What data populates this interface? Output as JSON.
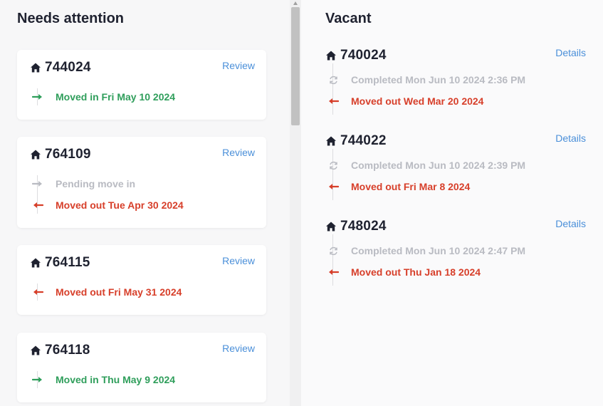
{
  "left": {
    "title": "Needs attention",
    "cards": [
      {
        "unit": "744024",
        "action": "Review",
        "events": [
          {
            "text": "Moved in Fri May 10 2024",
            "status": "green",
            "icon": "arrow-right-icon"
          }
        ]
      },
      {
        "unit": "764109",
        "action": "Review",
        "events": [
          {
            "text": "Pending move in",
            "status": "gray",
            "icon": "arrow-right-icon"
          },
          {
            "text": "Moved out Tue Apr 30 2024",
            "status": "red",
            "icon": "arrow-left-icon"
          }
        ]
      },
      {
        "unit": "764115",
        "action": "Review",
        "events": [
          {
            "text": "Moved out Fri May 31 2024",
            "status": "red",
            "icon": "arrow-left-icon"
          }
        ]
      },
      {
        "unit": "764118",
        "action": "Review",
        "events": [
          {
            "text": "Moved in Thu May 9 2024",
            "status": "green",
            "icon": "arrow-right-icon"
          }
        ]
      }
    ]
  },
  "right": {
    "title": "Vacant",
    "units": [
      {
        "unit": "740024",
        "action": "Details",
        "events": [
          {
            "text": "Completed Mon Jun 10 2024 2:36 PM",
            "status": "gray",
            "icon": "refresh-icon"
          },
          {
            "text": "Moved out Wed Mar 20 2024",
            "status": "red",
            "icon": "arrow-left-icon"
          }
        ]
      },
      {
        "unit": "744022",
        "action": "Details",
        "events": [
          {
            "text": "Completed Mon Jun 10 2024 2:39 PM",
            "status": "gray",
            "icon": "refresh-icon"
          },
          {
            "text": "Moved out Fri Mar 8 2024",
            "status": "red",
            "icon": "arrow-left-icon"
          }
        ]
      },
      {
        "unit": "748024",
        "action": "Details",
        "events": [
          {
            "text": "Completed Mon Jun 10 2024 2:47 PM",
            "status": "gray",
            "icon": "refresh-icon"
          },
          {
            "text": "Moved out Thu Jan 18 2024",
            "status": "red",
            "icon": "arrow-left-icon"
          }
        ]
      }
    ]
  },
  "colors": {
    "green": "#2f9e5b",
    "red": "#d73f2a",
    "gray": "#b9bbc2",
    "link": "#4a8fd9"
  }
}
